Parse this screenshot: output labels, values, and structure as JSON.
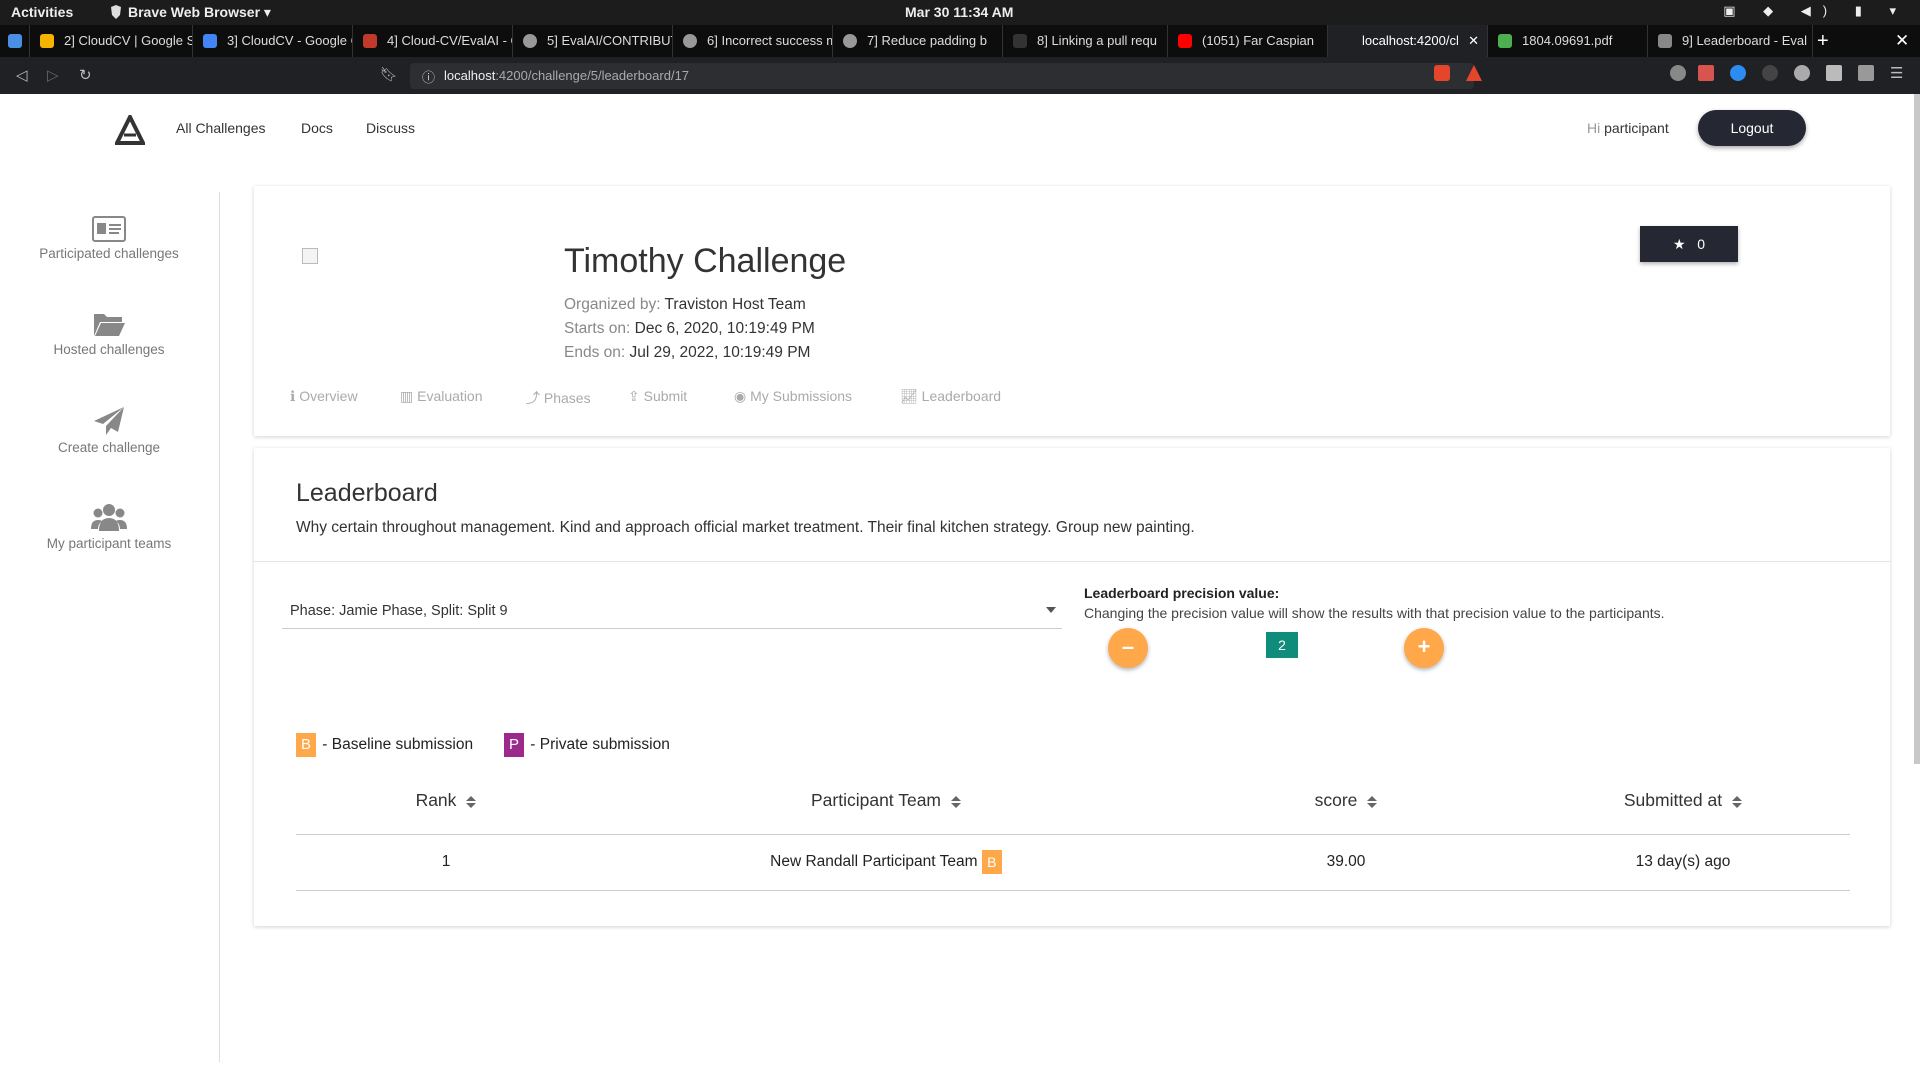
{
  "os": {
    "activities": "Activities",
    "app_name": "Brave Web Browser",
    "clock": "Mar 30  11:34 AM"
  },
  "browser": {
    "tabs": [
      {
        "label": "2] CloudCV | Google S",
        "color": "#f4b400"
      },
      {
        "label": "3] CloudCV - Google C",
        "color": "#4285f4"
      },
      {
        "label": "4] Cloud-CV/EvalAI - G",
        "color": "#c0392b"
      },
      {
        "label": "5] EvalAI/CONTRIBUTI",
        "color": "#999999"
      },
      {
        "label": "6] Incorrect success m",
        "color": "#999999"
      },
      {
        "label": "7] Reduce padding b",
        "color": "#999999"
      },
      {
        "label": "8] Linking a pull requ",
        "color": "#333333"
      },
      {
        "label": "(1051) Far Caspian",
        "color": "#ff0000"
      },
      {
        "label": "localhost:4200/cl",
        "color": "#202124"
      },
      {
        "label": "1804.09691.pdf",
        "color": "#4caf50"
      },
      {
        "label": "9] Leaderboard - Eval",
        "color": "#888888"
      }
    ],
    "url_host": "localhost",
    "url_path": ":4200/challenge/5/leaderboard/17"
  },
  "header": {
    "nav": [
      "All Challenges",
      "Docs",
      "Discuss"
    ],
    "greeting": "Hi",
    "username": "participant",
    "logout": "Logout"
  },
  "sidebar": {
    "items": [
      {
        "label": "Participated challenges",
        "icon": "id-card-icon"
      },
      {
        "label": "Hosted challenges",
        "icon": "folder-open-icon"
      },
      {
        "label": "Create challenge",
        "icon": "paper-plane-icon"
      },
      {
        "label": "My participant teams",
        "icon": "users-icon"
      }
    ]
  },
  "challenge": {
    "title": "Timothy Challenge",
    "organized_label": "Organized by:",
    "organizer": "Traviston Host Team",
    "starts_label": "Starts on:",
    "starts": "Dec 6, 2020, 10:19:49 PM",
    "ends_label": "Ends on:",
    "ends": "Jul 29, 2022, 10:19:49 PM",
    "stars": "0",
    "tabs": [
      "Overview",
      "Evaluation",
      "Phases",
      "Submit",
      "My Submissions",
      "Leaderboard"
    ]
  },
  "leaderboard": {
    "title": "Leaderboard",
    "description": "Why certain throughout management. Kind and approach official market treatment. Their final kitchen strategy. Group new painting.",
    "phase_select": "Phase: Jamie Phase, Split:  Split 9",
    "precision_label": "Leaderboard precision value:",
    "precision_help": "Changing the precision value will show the results with that precision value to the participants.",
    "precision_value": "2",
    "minus": "–",
    "plus": "+",
    "legend_baseline_badge": "B",
    "legend_baseline": " - Baseline submission",
    "legend_private_badge": "P",
    "legend_private": " - Private submission",
    "columns": [
      "Rank",
      "Participant Team",
      "score",
      "Submitted at"
    ],
    "rows": [
      {
        "rank": "1",
        "team": "New Randall Participant Team",
        "badge": "B",
        "score": "39.00",
        "submitted": "13 day(s) ago"
      }
    ]
  }
}
